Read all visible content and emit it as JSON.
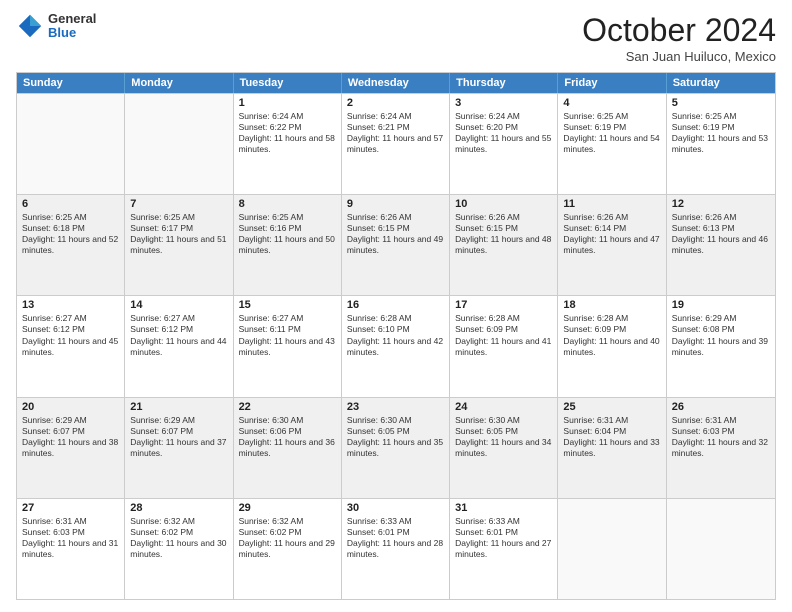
{
  "header": {
    "logo": {
      "general": "General",
      "blue": "Blue"
    },
    "title": "October 2024",
    "subtitle": "San Juan Huiluco, Mexico"
  },
  "days_of_week": [
    "Sunday",
    "Monday",
    "Tuesday",
    "Wednesday",
    "Thursday",
    "Friday",
    "Saturday"
  ],
  "weeks": [
    [
      {
        "day": "",
        "sunrise": "",
        "sunset": "",
        "daylight": "",
        "empty": true
      },
      {
        "day": "",
        "sunrise": "",
        "sunset": "",
        "daylight": "",
        "empty": true
      },
      {
        "day": "1",
        "sunrise": "Sunrise: 6:24 AM",
        "sunset": "Sunset: 6:22 PM",
        "daylight": "Daylight: 11 hours and 58 minutes."
      },
      {
        "day": "2",
        "sunrise": "Sunrise: 6:24 AM",
        "sunset": "Sunset: 6:21 PM",
        "daylight": "Daylight: 11 hours and 57 minutes."
      },
      {
        "day": "3",
        "sunrise": "Sunrise: 6:24 AM",
        "sunset": "Sunset: 6:20 PM",
        "daylight": "Daylight: 11 hours and 55 minutes."
      },
      {
        "day": "4",
        "sunrise": "Sunrise: 6:25 AM",
        "sunset": "Sunset: 6:19 PM",
        "daylight": "Daylight: 11 hours and 54 minutes."
      },
      {
        "day": "5",
        "sunrise": "Sunrise: 6:25 AM",
        "sunset": "Sunset: 6:19 PM",
        "daylight": "Daylight: 11 hours and 53 minutes."
      }
    ],
    [
      {
        "day": "6",
        "sunrise": "Sunrise: 6:25 AM",
        "sunset": "Sunset: 6:18 PM",
        "daylight": "Daylight: 11 hours and 52 minutes."
      },
      {
        "day": "7",
        "sunrise": "Sunrise: 6:25 AM",
        "sunset": "Sunset: 6:17 PM",
        "daylight": "Daylight: 11 hours and 51 minutes."
      },
      {
        "day": "8",
        "sunrise": "Sunrise: 6:25 AM",
        "sunset": "Sunset: 6:16 PM",
        "daylight": "Daylight: 11 hours and 50 minutes."
      },
      {
        "day": "9",
        "sunrise": "Sunrise: 6:26 AM",
        "sunset": "Sunset: 6:15 PM",
        "daylight": "Daylight: 11 hours and 49 minutes."
      },
      {
        "day": "10",
        "sunrise": "Sunrise: 6:26 AM",
        "sunset": "Sunset: 6:15 PM",
        "daylight": "Daylight: 11 hours and 48 minutes."
      },
      {
        "day": "11",
        "sunrise": "Sunrise: 6:26 AM",
        "sunset": "Sunset: 6:14 PM",
        "daylight": "Daylight: 11 hours and 47 minutes."
      },
      {
        "day": "12",
        "sunrise": "Sunrise: 6:26 AM",
        "sunset": "Sunset: 6:13 PM",
        "daylight": "Daylight: 11 hours and 46 minutes."
      }
    ],
    [
      {
        "day": "13",
        "sunrise": "Sunrise: 6:27 AM",
        "sunset": "Sunset: 6:12 PM",
        "daylight": "Daylight: 11 hours and 45 minutes."
      },
      {
        "day": "14",
        "sunrise": "Sunrise: 6:27 AM",
        "sunset": "Sunset: 6:12 PM",
        "daylight": "Daylight: 11 hours and 44 minutes."
      },
      {
        "day": "15",
        "sunrise": "Sunrise: 6:27 AM",
        "sunset": "Sunset: 6:11 PM",
        "daylight": "Daylight: 11 hours and 43 minutes."
      },
      {
        "day": "16",
        "sunrise": "Sunrise: 6:28 AM",
        "sunset": "Sunset: 6:10 PM",
        "daylight": "Daylight: 11 hours and 42 minutes."
      },
      {
        "day": "17",
        "sunrise": "Sunrise: 6:28 AM",
        "sunset": "Sunset: 6:09 PM",
        "daylight": "Daylight: 11 hours and 41 minutes."
      },
      {
        "day": "18",
        "sunrise": "Sunrise: 6:28 AM",
        "sunset": "Sunset: 6:09 PM",
        "daylight": "Daylight: 11 hours and 40 minutes."
      },
      {
        "day": "19",
        "sunrise": "Sunrise: 6:29 AM",
        "sunset": "Sunset: 6:08 PM",
        "daylight": "Daylight: 11 hours and 39 minutes."
      }
    ],
    [
      {
        "day": "20",
        "sunrise": "Sunrise: 6:29 AM",
        "sunset": "Sunset: 6:07 PM",
        "daylight": "Daylight: 11 hours and 38 minutes."
      },
      {
        "day": "21",
        "sunrise": "Sunrise: 6:29 AM",
        "sunset": "Sunset: 6:07 PM",
        "daylight": "Daylight: 11 hours and 37 minutes."
      },
      {
        "day": "22",
        "sunrise": "Sunrise: 6:30 AM",
        "sunset": "Sunset: 6:06 PM",
        "daylight": "Daylight: 11 hours and 36 minutes."
      },
      {
        "day": "23",
        "sunrise": "Sunrise: 6:30 AM",
        "sunset": "Sunset: 6:05 PM",
        "daylight": "Daylight: 11 hours and 35 minutes."
      },
      {
        "day": "24",
        "sunrise": "Sunrise: 6:30 AM",
        "sunset": "Sunset: 6:05 PM",
        "daylight": "Daylight: 11 hours and 34 minutes."
      },
      {
        "day": "25",
        "sunrise": "Sunrise: 6:31 AM",
        "sunset": "Sunset: 6:04 PM",
        "daylight": "Daylight: 11 hours and 33 minutes."
      },
      {
        "day": "26",
        "sunrise": "Sunrise: 6:31 AM",
        "sunset": "Sunset: 6:03 PM",
        "daylight": "Daylight: 11 hours and 32 minutes."
      }
    ],
    [
      {
        "day": "27",
        "sunrise": "Sunrise: 6:31 AM",
        "sunset": "Sunset: 6:03 PM",
        "daylight": "Daylight: 11 hours and 31 minutes."
      },
      {
        "day": "28",
        "sunrise": "Sunrise: 6:32 AM",
        "sunset": "Sunset: 6:02 PM",
        "daylight": "Daylight: 11 hours and 30 minutes."
      },
      {
        "day": "29",
        "sunrise": "Sunrise: 6:32 AM",
        "sunset": "Sunset: 6:02 PM",
        "daylight": "Daylight: 11 hours and 29 minutes."
      },
      {
        "day": "30",
        "sunrise": "Sunrise: 6:33 AM",
        "sunset": "Sunset: 6:01 PM",
        "daylight": "Daylight: 11 hours and 28 minutes."
      },
      {
        "day": "31",
        "sunrise": "Sunrise: 6:33 AM",
        "sunset": "Sunset: 6:01 PM",
        "daylight": "Daylight: 11 hours and 27 minutes."
      },
      {
        "day": "",
        "sunrise": "",
        "sunset": "",
        "daylight": "",
        "empty": true
      },
      {
        "day": "",
        "sunrise": "",
        "sunset": "",
        "daylight": "",
        "empty": true
      }
    ]
  ]
}
